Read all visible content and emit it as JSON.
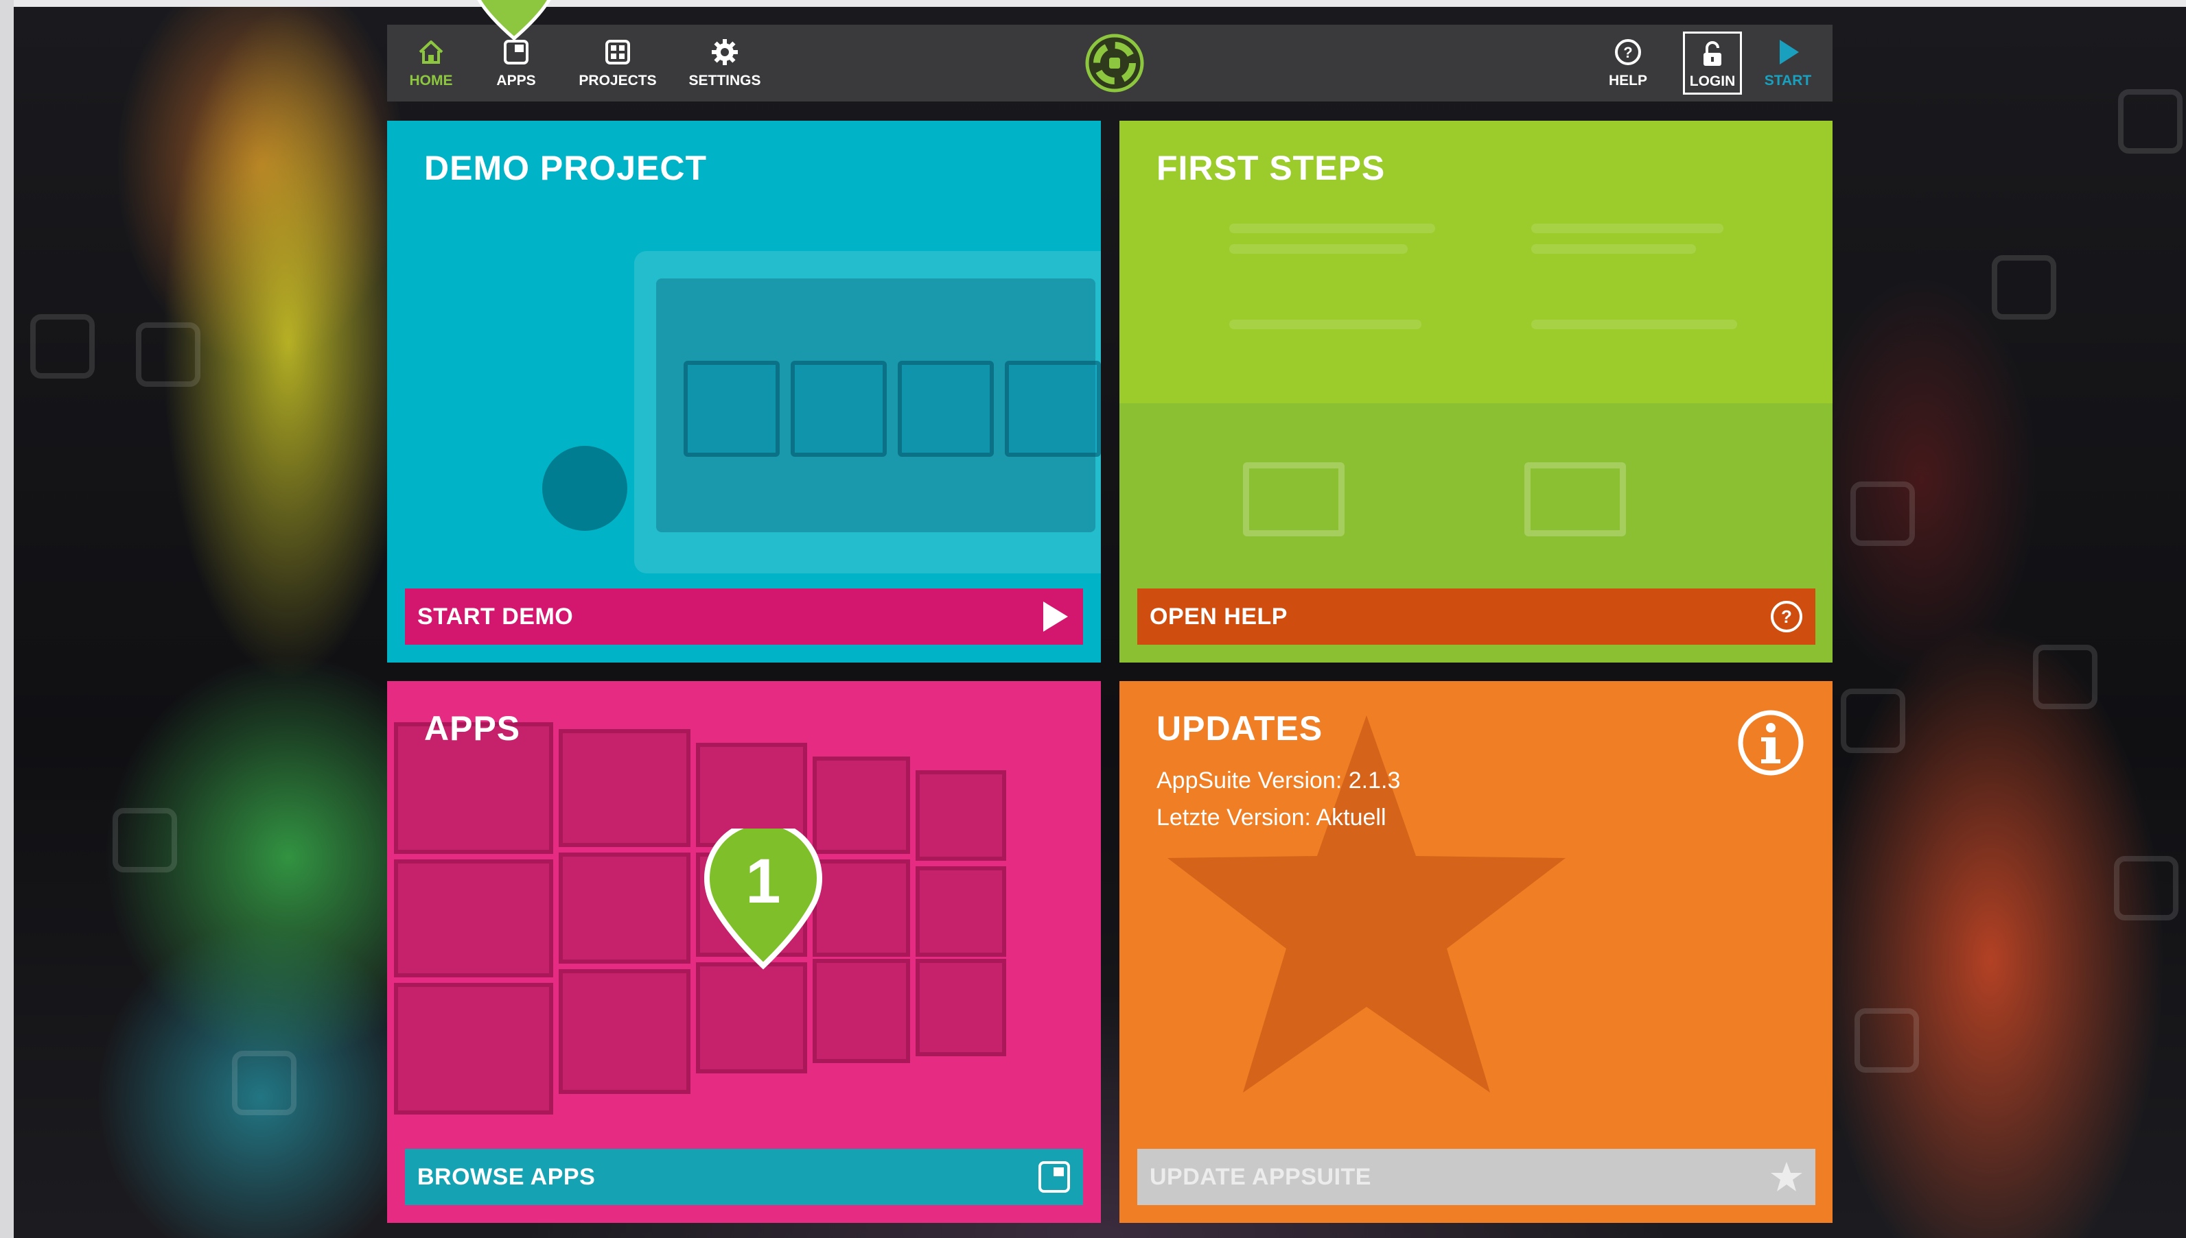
{
  "nav": {
    "home": "HOME",
    "apps": "APPS",
    "projects": "PROJECTS",
    "settings": "SETTINGS",
    "help": "HELP",
    "login": "LOGIN",
    "start": "START"
  },
  "tiles": {
    "demo": {
      "title": "DEMO PROJECT",
      "action": "START DEMO"
    },
    "first_steps": {
      "title": "FIRST STEPS",
      "action": "OPEN HELP"
    },
    "apps": {
      "title": "APPS",
      "action": "BROWSE APPS"
    },
    "updates": {
      "title": "UPDATES",
      "version_line": "AppSuite Version: 2.1.3",
      "latest_line": "Letzte Version: Aktuell",
      "action": "UPDATE APPSUITE"
    }
  },
  "tour_marker": {
    "number": "1"
  },
  "icons": {
    "home": "home-icon",
    "apps": "apps-icon",
    "projects": "projects-icon",
    "settings": "gear-icon",
    "help": "help-icon",
    "login": "unlock-icon",
    "start": "play-icon",
    "info": "info-icon",
    "star": "star-icon"
  },
  "colors": {
    "accent_green": "#8dc63f",
    "topbar": "#3a3a3d",
    "demo_tile": "#00b3c6",
    "first_steps_tile": "#9bcc2c",
    "apps_tile": "#e52c82",
    "updates_tile": "#ef7e24",
    "start_blue": "#1aa0bf"
  }
}
